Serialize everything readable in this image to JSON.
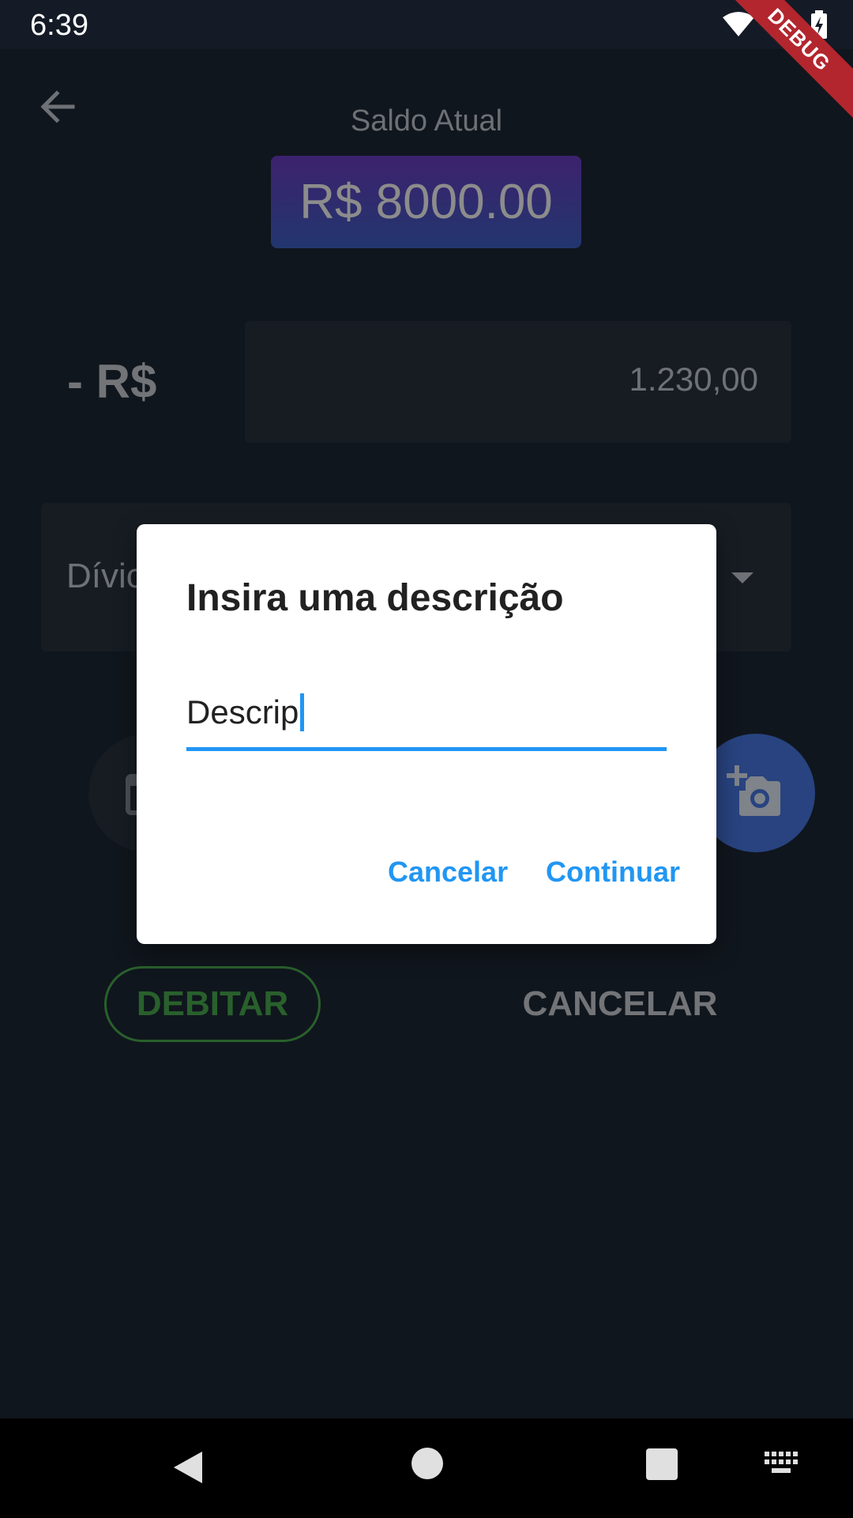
{
  "status_bar": {
    "time": "6:39",
    "debug_label": "DEBUG"
  },
  "app": {
    "back_icon": "arrow-back-icon",
    "balance_label": "Saldo Atual",
    "balance_value": "R$ 8000.00",
    "amount_prefix": "- R$",
    "amount_value": "1.230,00",
    "category_value": "Dívic",
    "calendar_icon": "calendar-icon",
    "camera_icon": "add-camera-icon",
    "debit_label": "DEBITAR",
    "cancel_label": "CANCELAR"
  },
  "dialog": {
    "title": "Insira uma descrição",
    "input_value": "Descrip",
    "cancel_label": "Cancelar",
    "continue_label": "Continuar"
  },
  "colors": {
    "background": "#1e2836",
    "accent": "#2196f3",
    "debit_green": "#4caf50",
    "camera_blue": "#4a7be8",
    "debug_ribbon": "#b3262e"
  }
}
